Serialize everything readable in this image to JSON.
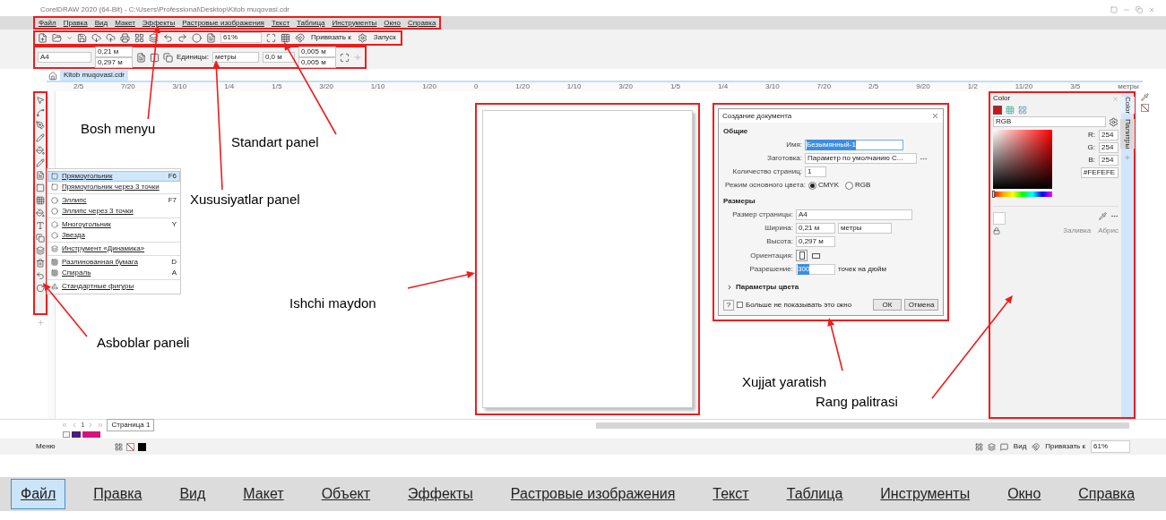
{
  "window": {
    "title": "CorelDRAW 2020 (64-Bit) - C:\\Users\\Professional\\Desktop\\Kitob muqovasi.cdr"
  },
  "menu": [
    {
      "label": "Файл"
    },
    {
      "label": "Правка"
    },
    {
      "label": "Вид"
    },
    {
      "label": "Макет"
    },
    {
      "label": "Эффекты"
    },
    {
      "label": "Растровые изображения"
    },
    {
      "label": "Текст"
    },
    {
      "label": "Таблица"
    },
    {
      "label": "Инструменты"
    },
    {
      "label": "Окно"
    },
    {
      "label": "Справка"
    }
  ],
  "toolbar": {
    "zoom": "61%",
    "snap": "Привязать к",
    "launch": "Запуск"
  },
  "property_bar": {
    "page_size": "A4",
    "width": "0,21 м",
    "height": "0,297 м",
    "units_label": "Единицы:",
    "units": "метры",
    "nudge": "0,0 м",
    "dup_x": "0,005 м",
    "dup_y": "0,005 м"
  },
  "document_tabs": [
    {
      "label": "Kitob muqovasi.cdr",
      "selected": true
    }
  ],
  "ruler": [
    "2/5",
    "7/20",
    "3/10",
    "1/4",
    "1/5",
    "3/20",
    "1/10",
    "1/20",
    "0",
    "1/20",
    "1/10",
    "3/20",
    "1/5",
    "1/4",
    "3/10",
    "7/20",
    "2/5",
    "9/20",
    "1/2",
    "11/20",
    "3/5",
    "метры"
  ],
  "flyout": [
    {
      "items": [
        {
          "label": "Прямоугольник",
          "shortcut": "F6",
          "selected": true
        },
        {
          "label": "Прямоугольник через 3 точки",
          "selected": false
        }
      ]
    },
    {
      "items": [
        {
          "label": "Эллипс",
          "shortcut": "F7",
          "selected": false
        },
        {
          "label": "Эллипс через 3 точки",
          "selected": false
        }
      ]
    },
    {
      "items": [
        {
          "label": "Многоугольник",
          "shortcut": "Y",
          "selected": false
        },
        {
          "label": "Звезда",
          "selected": false
        }
      ]
    },
    {
      "items": [
        {
          "label": "Инструмент «Динамика»",
          "selected": false
        }
      ]
    },
    {
      "items": [
        {
          "label": "Разлинованная бумага",
          "shortcut": "D",
          "selected": false
        },
        {
          "label": "Спираль",
          "shortcut": "A",
          "selected": false
        }
      ]
    },
    {
      "items": [
        {
          "label": "Стандартные фигуры",
          "selected": false
        }
      ]
    }
  ],
  "dialog": {
    "title": "Создание документа",
    "general": "Общие",
    "name_label": "Имя:",
    "name": "Безымянный-1",
    "preset_label": "Заготовка:",
    "preset": "Параметр по умолчанию C...",
    "pages_label": "Количество страниц:",
    "pages": "1",
    "color_mode_label": "Режим основного цвета:",
    "color_modes": [
      {
        "label": "CMYK",
        "selected": true
      },
      {
        "label": "RGB",
        "selected": false
      }
    ],
    "sizes": "Размеры",
    "page_size_label": "Размер страницы:",
    "page_size": "A4",
    "width_label": "Ширина:",
    "width": "0,21 м",
    "units": "метры",
    "height_label": "Высота:",
    "height": "0,297 м",
    "orientation_label": "Ориентация:",
    "orientations": [
      {
        "kind": "portrait",
        "selected": true
      },
      {
        "kind": "landscape",
        "selected": false
      }
    ],
    "resolution_label": "Разрешение:",
    "resolution": "300",
    "resolution_unit": "точек на дюйм",
    "color_settings": {
      "label": "Параметры цвета",
      "expanded": false
    },
    "help": "?",
    "dont_show": {
      "label": "Больше не показывать это окно",
      "checked": false
    },
    "ok": "ОК",
    "cancel": "Отмена"
  },
  "color_docker": {
    "title": "Color",
    "model": "RGB",
    "r_label": "R:",
    "r": "254",
    "g_label": "G:",
    "g": "254",
    "b_label": "B:",
    "b": "254",
    "hex": "#FEFEFE",
    "hue": {
      "level": 0
    },
    "fill": "Заливка",
    "outline": "Абрис",
    "tabs": [
      {
        "label": "Color",
        "selected": true
      },
      {
        "label": "Палитры",
        "selected": false
      }
    ]
  },
  "page_nav": {
    "page": "1"
  },
  "page_tabs": [
    {
      "label": "Страница 1",
      "selected": true
    }
  ],
  "status_bar": {
    "menu": "Меню",
    "view": "Вид",
    "snap": "Привязать к",
    "zoom": "61%"
  },
  "big_menu": [
    {
      "label": "Файл",
      "selected": true
    },
    {
      "label": "Правка",
      "selected": false
    },
    {
      "label": "Вид",
      "selected": false
    },
    {
      "label": "Макет",
      "selected": false
    },
    {
      "label": "Объект",
      "selected": false
    },
    {
      "label": "Эффекты",
      "selected": false
    },
    {
      "label": "Растровые изображения",
      "selected": false
    },
    {
      "label": "Текст",
      "selected": false
    },
    {
      "label": "Таблица",
      "selected": false
    },
    {
      "label": "Инструменты",
      "selected": false
    },
    {
      "label": "Окно",
      "selected": false
    },
    {
      "label": "Справка",
      "selected": false
    }
  ],
  "annotations": [
    {
      "label": "Bosh menyu"
    },
    {
      "label": "Standart panel"
    },
    {
      "label": "Xususiyatlar panel"
    },
    {
      "label": "Asboblar paneli"
    },
    {
      "label": "Ishchi maydon"
    },
    {
      "label": "Xujjat yaratish"
    },
    {
      "label": "Rang palitrasi"
    }
  ]
}
